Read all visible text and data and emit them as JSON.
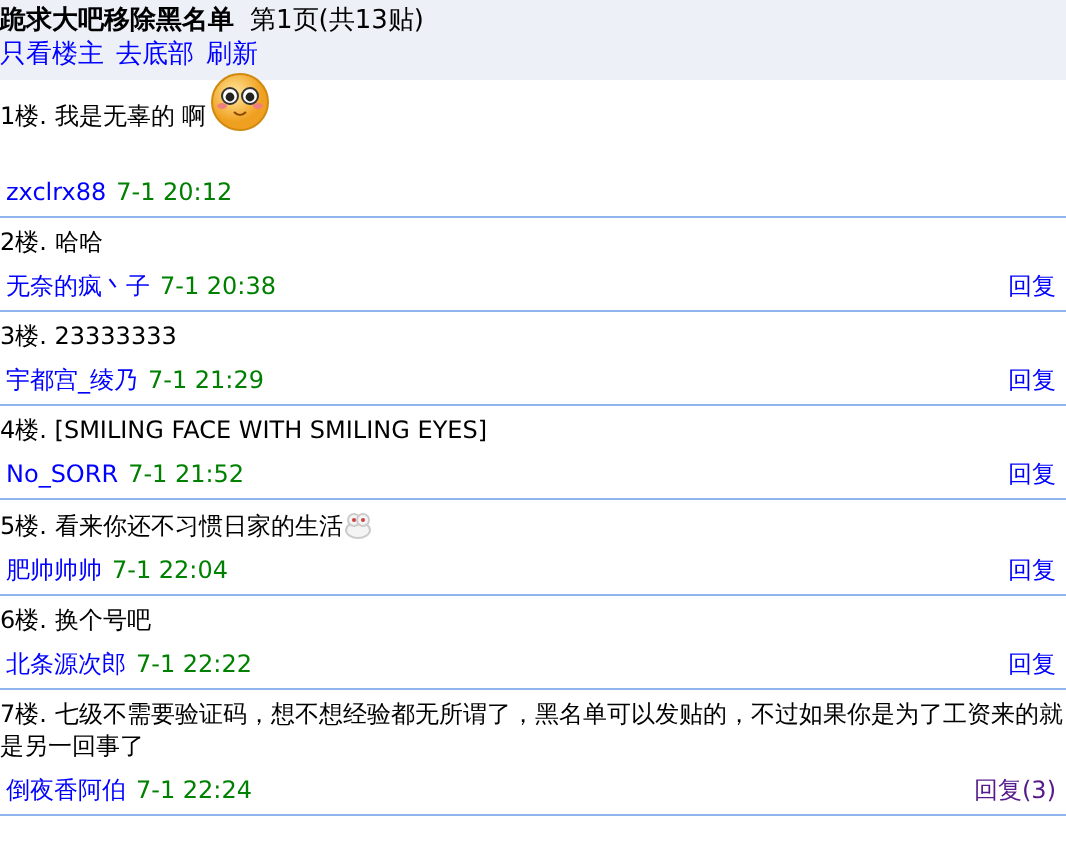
{
  "header": {
    "title": "跪求大吧移除黑名单",
    "page_info": "第1页(共13贴)",
    "links": [
      "只看楼主",
      "去底部",
      "刷新"
    ]
  },
  "posts": [
    {
      "floor": "1楼.",
      "text": "我是无辜的 啊",
      "kind": "face",
      "author": "zxclrx88",
      "time": "7-1 20:12"
    },
    {
      "floor": "2楼.",
      "text": "哈哈",
      "author": "无奈的疯丶子",
      "time": "7-1 20:38",
      "reply": "回复",
      "visited": false
    },
    {
      "floor": "3楼.",
      "text": "23333333",
      "author": "宇都宫_绫乃",
      "time": "7-1 21:29",
      "reply": "回复",
      "visited": false
    },
    {
      "floor": "4楼.",
      "text": "[SMILING FACE WITH SMILING EYES]",
      "author": "No_SORR",
      "time": "7-1 21:52",
      "reply": "回复",
      "visited": false
    },
    {
      "floor": "5楼.",
      "text": "看来你还不习惯日家的生活",
      "kind": "bunny",
      "author": "肥帅帅帅",
      "time": "7-1 22:04",
      "reply": "回复",
      "visited": false
    },
    {
      "floor": "6楼.",
      "text": "换个号吧",
      "author": "北条源次郎",
      "time": "7-1 22:22",
      "reply": "回复",
      "visited": false
    },
    {
      "floor": "7楼.",
      "text": "七级不需要验证码，想不想经验都无所谓了，黑名单可以发贴的，不过如果你是为了工资来的就是另一回事了",
      "author": "倒夜香阿伯",
      "time": "7-1 22:24",
      "reply": "回复(3)",
      "visited": true
    }
  ]
}
